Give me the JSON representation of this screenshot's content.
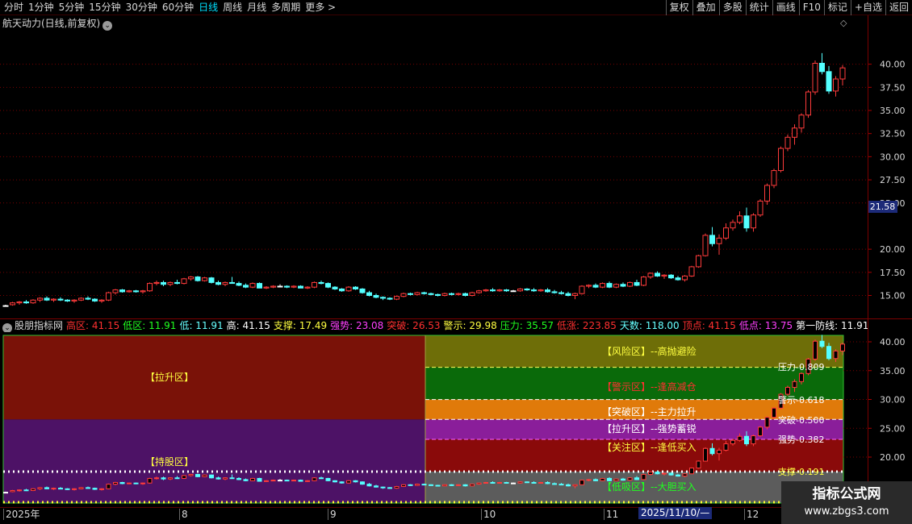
{
  "toolbar": {
    "periods": [
      "分时",
      "1分钟",
      "5分钟",
      "15分钟",
      "30分钟",
      "60分钟",
      "日线",
      "周线",
      "月线",
      "多周期",
      "更多 >"
    ],
    "active_period": "日线",
    "tools": [
      "复权",
      "叠加",
      "多股",
      "统计",
      "画线",
      "F10",
      "标记",
      "+自选",
      "返回"
    ]
  },
  "main_panel": {
    "title": "航天动力(日线,前复权)",
    "title_icon": "chevron-down-icon",
    "corner_icon": "diamond-icon",
    "price_axis_ticks": [
      "40.00",
      "37.50",
      "35.00",
      "32.50",
      "30.00",
      "27.50",
      "25.00",
      "20.00",
      "17.50",
      "15.00"
    ],
    "current_price_tag": "21.58",
    "colors": {
      "up": "#ff3b3b",
      "down": "#54ffff",
      "grid": "#7a0000",
      "flat": "#ffffff"
    }
  },
  "indicator_panel": {
    "name": "股朋指标网",
    "stats": [
      {
        "label": "高区:",
        "value": "41.15",
        "color": "#ff3030"
      },
      {
        "label": "低区:",
        "value": "11.91",
        "color": "#20ff20"
      },
      {
        "label": "低:",
        "value": "11.91",
        "color": "#66ffff"
      },
      {
        "label": "高:",
        "value": "41.15",
        "color": "#ffffff"
      },
      {
        "label": "支撑:",
        "value": "17.49",
        "color": "#ffff40"
      },
      {
        "label": "强势:",
        "value": "23.08",
        "color": "#ff40ff"
      },
      {
        "label": "突破:",
        "value": "26.53",
        "color": "#ff3030"
      },
      {
        "label": "警示:",
        "value": "29.98",
        "color": "#ffff40"
      },
      {
        "label": "压力:",
        "value": "35.57",
        "color": "#20ff20"
      },
      {
        "label": "低涨:",
        "value": "223.85",
        "color": "#ff3030"
      },
      {
        "label": "天数:",
        "value": "118.00",
        "color": "#66ffff"
      },
      {
        "label": "顶点:",
        "value": "41.15",
        "color": "#ff3030"
      },
      {
        "label": "低点:",
        "value": "13.75",
        "color": "#ff40ff"
      },
      {
        "label": "第一防线:",
        "value": "11.91",
        "color": "#ffffff"
      },
      {
        "label": "第二防线:",
        "value": "",
        "color": "#ffffff"
      }
    ],
    "left_zones": [
      "【拉升区】",
      "【持股区】"
    ],
    "right_zones": [
      {
        "text": "【风险区】--高抛避险",
        "color": "#ffff40"
      },
      {
        "text": "【警示区】--逢高减仓",
        "color": "#ff3030"
      },
      {
        "text": "【突破区】--主力拉升",
        "color": "#ffffff"
      },
      {
        "text": "【拉升区】--强势蓄锐",
        "color": "#ffffff"
      },
      {
        "text": "【关注区】--逢低买入",
        "color": "#ffff40"
      },
      {
        "text": "【低吸区】--大胆买入",
        "color": "#20ff20"
      }
    ],
    "levels": [
      "压力-0.809",
      "警示-0.618",
      "突破-0.500",
      "强势-0.382",
      "支撑-0.191"
    ],
    "axis_ticks": [
      "40.00",
      "35.00",
      "30.00",
      "25.00",
      "20.00",
      "15.00"
    ]
  },
  "date_axis": {
    "labels": [
      "2025年",
      "8",
      "9",
      "10",
      "11",
      "12"
    ],
    "cursor_date": "2025/11/10/—"
  },
  "watermark": {
    "title": "指标公式网",
    "url": "www.zbgs3.com"
  },
  "chart_data": {
    "type": "candlestick",
    "title": "航天动力(日线,前复权)",
    "y_range": [
      13.5,
      42.0
    ],
    "candles_ohlc": [
      [
        13.9,
        14.0,
        13.8,
        13.9
      ],
      [
        14.0,
        14.3,
        13.9,
        14.2
      ],
      [
        14.2,
        14.4,
        14.0,
        14.3
      ],
      [
        14.3,
        14.5,
        14.1,
        14.2
      ],
      [
        14.2,
        14.6,
        14.1,
        14.5
      ],
      [
        14.5,
        14.8,
        14.3,
        14.7
      ],
      [
        14.7,
        14.9,
        14.4,
        14.5
      ],
      [
        14.5,
        14.7,
        14.3,
        14.6
      ],
      [
        14.6,
        14.8,
        14.4,
        14.5
      ],
      [
        14.5,
        14.6,
        14.3,
        14.4
      ],
      [
        14.4,
        14.6,
        14.2,
        14.5
      ],
      [
        14.5,
        14.8,
        14.4,
        14.7
      ],
      [
        14.7,
        14.9,
        14.5,
        14.6
      ],
      [
        14.6,
        14.7,
        14.3,
        14.4
      ],
      [
        14.4,
        14.6,
        14.2,
        14.5
      ],
      [
        14.5,
        15.4,
        14.4,
        15.3
      ],
      [
        15.3,
        15.7,
        15.1,
        15.6
      ],
      [
        15.6,
        15.7,
        15.3,
        15.4
      ],
      [
        15.4,
        15.6,
        15.3,
        15.5
      ],
      [
        15.5,
        15.6,
        15.3,
        15.4
      ],
      [
        15.4,
        15.6,
        15.2,
        15.5
      ],
      [
        15.5,
        16.4,
        15.4,
        16.3
      ],
      [
        16.3,
        16.6,
        16.1,
        16.4
      ],
      [
        16.4,
        16.6,
        16.0,
        16.2
      ],
      [
        16.2,
        16.5,
        16.0,
        16.4
      ],
      [
        16.4,
        16.7,
        16.2,
        16.3
      ],
      [
        16.3,
        16.9,
        16.2,
        16.8
      ],
      [
        16.8,
        17.1,
        16.6,
        17.0
      ],
      [
        17.0,
        17.1,
        16.5,
        16.6
      ],
      [
        16.6,
        17.0,
        16.5,
        16.9
      ],
      [
        16.9,
        17.0,
        16.3,
        16.4
      ],
      [
        16.4,
        16.6,
        16.1,
        16.2
      ],
      [
        16.2,
        16.5,
        16.0,
        16.4
      ],
      [
        16.4,
        17.0,
        16.3,
        16.3
      ],
      [
        16.3,
        16.5,
        16.0,
        16.1
      ],
      [
        16.1,
        16.3,
        15.8,
        15.9
      ],
      [
        15.9,
        16.4,
        15.8,
        16.3
      ],
      [
        16.3,
        16.4,
        15.8,
        15.8
      ],
      [
        15.8,
        16.0,
        15.7,
        15.9
      ],
      [
        15.9,
        16.1,
        15.8,
        16.0
      ],
      [
        16.0,
        16.2,
        15.9,
        16.0
      ],
      [
        16.0,
        16.1,
        15.8,
        15.9
      ],
      [
        15.9,
        16.1,
        15.8,
        16.0
      ],
      [
        16.0,
        16.1,
        15.8,
        15.8
      ],
      [
        15.8,
        16.0,
        15.7,
        15.9
      ],
      [
        15.9,
        16.5,
        15.8,
        16.4
      ],
      [
        16.4,
        16.6,
        16.2,
        16.3
      ],
      [
        16.3,
        16.4,
        15.8,
        15.9
      ],
      [
        15.9,
        16.0,
        15.6,
        15.7
      ],
      [
        15.7,
        15.8,
        15.4,
        15.5
      ],
      [
        15.5,
        16.0,
        15.4,
        15.9
      ],
      [
        15.9,
        16.0,
        15.6,
        15.7
      ],
      [
        15.7,
        15.8,
        15.2,
        15.3
      ],
      [
        15.3,
        15.5,
        14.9,
        15.0
      ],
      [
        15.0,
        15.2,
        14.7,
        14.8
      ],
      [
        14.8,
        14.9,
        14.5,
        14.7
      ],
      [
        14.7,
        14.8,
        14.5,
        14.6
      ],
      [
        14.6,
        15.0,
        14.5,
        14.9
      ],
      [
        14.9,
        15.3,
        14.8,
        15.2
      ],
      [
        15.2,
        15.3,
        15.0,
        15.1
      ],
      [
        15.1,
        15.4,
        15.0,
        15.3
      ],
      [
        15.3,
        15.4,
        15.1,
        15.2
      ],
      [
        15.2,
        15.3,
        15.0,
        15.1
      ],
      [
        15.1,
        15.2,
        14.9,
        15.0
      ],
      [
        15.0,
        15.3,
        14.9,
        15.2
      ],
      [
        15.2,
        15.3,
        15.0,
        15.1
      ],
      [
        15.1,
        15.3,
        15.0,
        15.2
      ],
      [
        15.2,
        15.3,
        14.9,
        15.0
      ],
      [
        15.0,
        15.4,
        14.9,
        15.3
      ],
      [
        15.3,
        15.6,
        15.2,
        15.5
      ],
      [
        15.5,
        15.7,
        15.4,
        15.6
      ],
      [
        15.6,
        15.8,
        15.4,
        15.5
      ],
      [
        15.5,
        15.7,
        15.4,
        15.6
      ],
      [
        15.6,
        15.7,
        15.4,
        15.5
      ],
      [
        15.5,
        15.6,
        15.4,
        15.5
      ],
      [
        15.5,
        15.8,
        15.4,
        15.7
      ],
      [
        15.7,
        15.8,
        15.5,
        15.6
      ],
      [
        15.6,
        15.8,
        15.4,
        15.5
      ],
      [
        15.5,
        15.7,
        15.4,
        15.6
      ],
      [
        15.6,
        15.8,
        15.3,
        15.4
      ],
      [
        15.4,
        15.6,
        15.2,
        15.3
      ],
      [
        15.3,
        15.5,
        15.1,
        15.2
      ],
      [
        15.2,
        15.4,
        14.9,
        15.0
      ],
      [
        15.0,
        15.3,
        14.6,
        15.2
      ],
      [
        15.2,
        16.1,
        15.1,
        16.0
      ],
      [
        16.0,
        16.2,
        15.8,
        16.1
      ],
      [
        16.1,
        16.3,
        15.8,
        15.9
      ],
      [
        15.9,
        16.4,
        15.8,
        16.3
      ],
      [
        16.3,
        16.5,
        15.8,
        15.9
      ],
      [
        15.9,
        16.3,
        15.8,
        16.2
      ],
      [
        16.2,
        16.4,
        15.9,
        16.0
      ],
      [
        16.0,
        16.5,
        15.9,
        16.4
      ],
      [
        16.4,
        16.7,
        16.0,
        16.1
      ],
      [
        16.1,
        17.1,
        16.0,
        17.0
      ],
      [
        17.0,
        17.5,
        16.8,
        17.4
      ],
      [
        17.4,
        17.6,
        17.0,
        17.1
      ],
      [
        17.1,
        17.3,
        16.8,
        17.2
      ],
      [
        17.2,
        17.3,
        16.8,
        16.9
      ],
      [
        16.9,
        17.1,
        16.6,
        16.7
      ],
      [
        16.7,
        17.2,
        16.5,
        17.1
      ],
      [
        17.1,
        18.2,
        17.0,
        18.1
      ],
      [
        18.1,
        19.4,
        18.0,
        19.3
      ],
      [
        19.3,
        21.7,
        19.2,
        21.5
      ],
      [
        21.5,
        22.4,
        20.3,
        20.6
      ],
      [
        20.6,
        21.6,
        19.4,
        21.2
      ],
      [
        21.2,
        22.8,
        21.0,
        22.3
      ],
      [
        22.3,
        23.2,
        22.0,
        22.9
      ],
      [
        22.9,
        24.1,
        22.7,
        23.6
      ],
      [
        23.6,
        24.5,
        21.9,
        22.3
      ],
      [
        22.3,
        23.9,
        21.9,
        23.7
      ],
      [
        23.7,
        25.4,
        23.5,
        25.2
      ],
      [
        25.2,
        27.1,
        24.8,
        26.9
      ],
      [
        26.9,
        28.7,
        26.6,
        28.5
      ],
      [
        28.5,
        31.1,
        28.3,
        30.9
      ],
      [
        30.9,
        32.4,
        30.6,
        32.1
      ],
      [
        32.1,
        33.5,
        31.3,
        33.1
      ],
      [
        33.1,
        34.7,
        32.6,
        34.5
      ],
      [
        34.5,
        37.2,
        34.2,
        37.0
      ],
      [
        37.0,
        40.4,
        36.7,
        40.1
      ],
      [
        40.1,
        41.2,
        38.9,
        39.2
      ],
      [
        39.2,
        39.8,
        36.8,
        37.1
      ],
      [
        37.1,
        38.7,
        36.5,
        38.4
      ],
      [
        38.4,
        39.9,
        37.7,
        39.6
      ]
    ],
    "indicator_levels": {
      "高区": 41.15,
      "低区": 11.91,
      "压力": 35.57,
      "警示": 29.98,
      "突破": 26.53,
      "强势": 23.08,
      "支撑": 17.49
    }
  }
}
